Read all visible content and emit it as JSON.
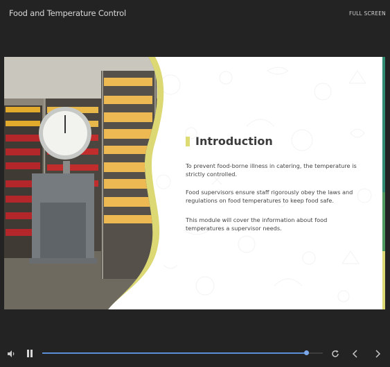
{
  "header": {
    "title": "Food and Temperature Control",
    "fullscreen_label": "FULL SCREEN"
  },
  "slide": {
    "heading": "Introduction",
    "paragraphs": [
      "To prevent food-borne illness in catering, the temperature is strictly controlled.",
      "Food supervisors ensure staff rigorously obey the laws and regulations on food temperatures to keep food safe.",
      "This module will cover the information about food temperatures a supervisor needs."
    ],
    "accent_color": "#dfdb73"
  },
  "player": {
    "progress_fraction": 0.94,
    "icons": {
      "volume": "volume-icon",
      "pause": "pause-icon",
      "replay": "replay-icon",
      "previous": "chevron-left-icon",
      "next": "chevron-right-icon"
    },
    "progress_color": "#5a8fd6"
  }
}
